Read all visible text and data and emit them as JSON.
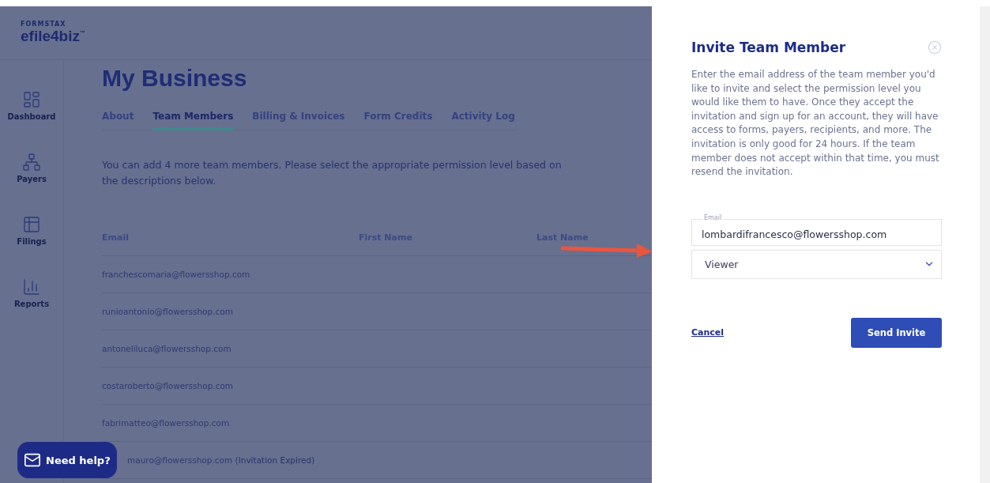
{
  "brand": {
    "maker": "FORMSTAX",
    "name": "efile4biz",
    "mark": "™"
  },
  "sidebar": {
    "items": [
      {
        "label": "Dashboard",
        "kind": "dashboard"
      },
      {
        "label": "Payers",
        "kind": "payers"
      },
      {
        "label": "Filings",
        "kind": "filings"
      },
      {
        "label": "Reports",
        "kind": "reports"
      }
    ]
  },
  "page": {
    "title": "My Business",
    "tabs": [
      {
        "label": "About",
        "selected": false
      },
      {
        "label": "Team Members",
        "selected": true
      },
      {
        "label": "Billing & Invoices",
        "selected": false
      },
      {
        "label": "Form Credits",
        "selected": false
      },
      {
        "label": "Activity Log",
        "selected": false
      }
    ],
    "intro": "You can add 4 more team members. Please select the appropriate permission level based on the descriptions below."
  },
  "table": {
    "columns": [
      "Email",
      "First Name",
      "Last Name"
    ],
    "rows": [
      {
        "email": "franchescomaria@flowersshop.com"
      },
      {
        "email": "runioantonio@flowersshop.com"
      },
      {
        "email": "antoneliluca@flowersshop.com"
      },
      {
        "email": "costaroberto@flowersshop.com"
      },
      {
        "email": "fabrimatteo@flowersshop.com"
      },
      {
        "email": "mauro@flowersshop.com",
        "note": "(Invitation Expired)"
      }
    ]
  },
  "help_button": {
    "label": "Need help?"
  },
  "dialog": {
    "title": "Invite Team Member",
    "text": "Enter the email address of the team member you'd like to invite and select the permission level you would like them to have. Once they accept the invitation and sign up for an account, they will have access to forms, payers, recipients, and more. The invitation is only good for 24 hours. If the team member does not accept within that time, you must resend the invitation.",
    "email_field": {
      "label": "Email",
      "value": "lombardifrancesco@flowersshop.com"
    },
    "permission_select": {
      "value": "Viewer"
    },
    "cancel": "Cancel",
    "submit": "Send Invite"
  }
}
